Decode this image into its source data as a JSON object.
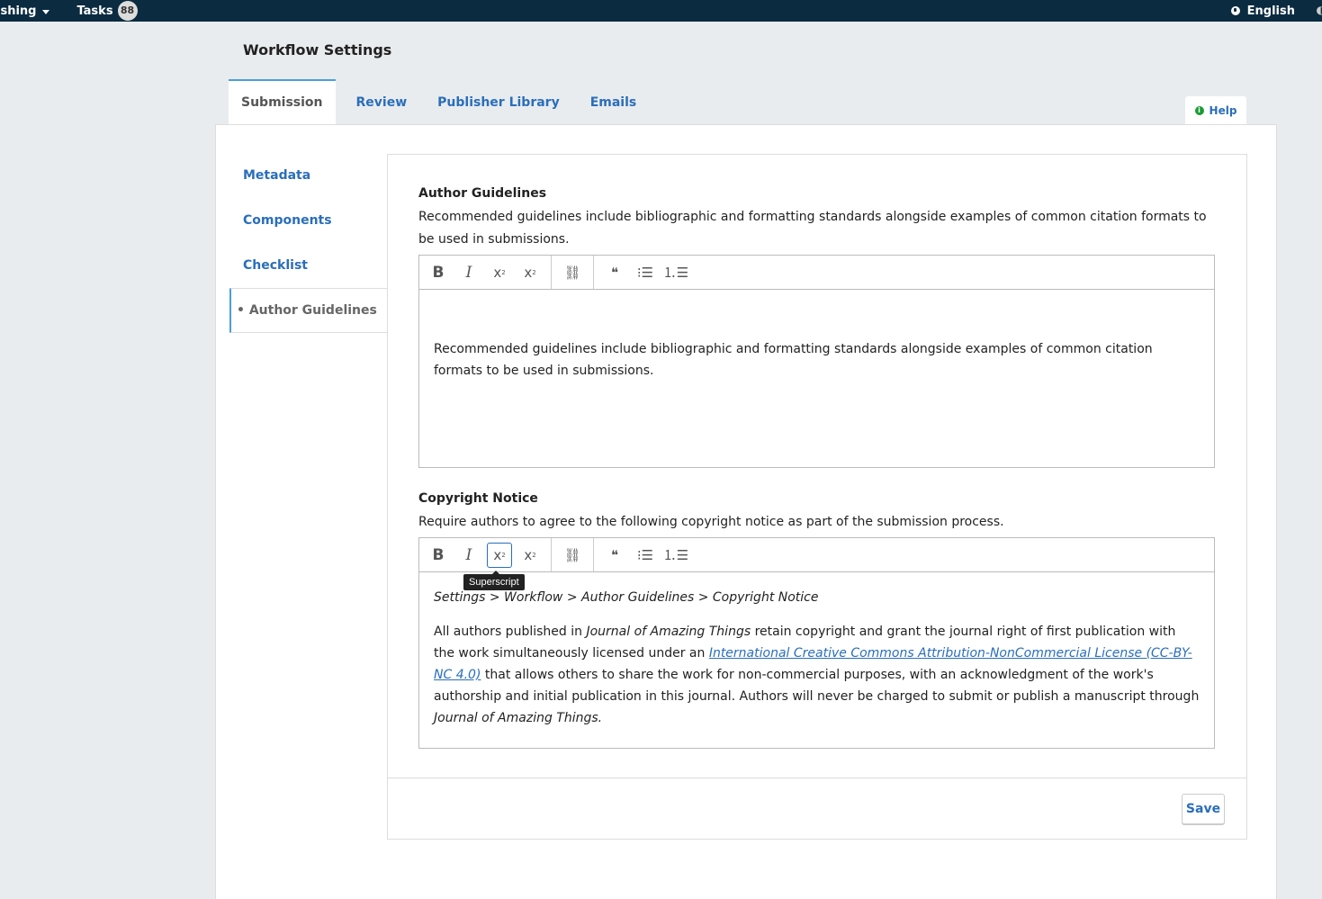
{
  "topbar": {
    "context_menu_label": "ishing",
    "tasks_label": "Tasks",
    "tasks_count": "88",
    "language_label": "English"
  },
  "page": {
    "title": "Workflow Settings"
  },
  "tabs": [
    {
      "label": "Submission",
      "active": true
    },
    {
      "label": "Review"
    },
    {
      "label": "Publisher Library"
    },
    {
      "label": "Emails"
    }
  ],
  "help": {
    "label": "Help"
  },
  "sidenav": [
    {
      "label": "Metadata"
    },
    {
      "label": "Components"
    },
    {
      "label": "Checklist"
    },
    {
      "label": "• Author Guidelines",
      "active": true
    }
  ],
  "author_guidelines": {
    "label": "Author Guidelines",
    "description": "Recommended guidelines include bibliographic and formatting standards alongside examples of common citation formats to be used in submissions.",
    "value": "Recommended guidelines include bibliographic and formatting standards alongside examples of common citation formats to be used in submissions."
  },
  "copyright_notice": {
    "label": "Copyright Notice",
    "description": "Require authors to agree to the following copyright notice as part of the submission process.",
    "breadcrumb": "Settings > Workflow > Author Guidelines > Copyright Notice",
    "p1": "All authors published in ",
    "journal": "Journal of Amazing Things",
    "p2": " retain copyright and grant the journal right of first publication with the work simultaneously licensed under an ",
    "license_link": "International Creative Commons Attribution-NonCommercial License (CC-BY-NC 4.0)",
    "p3": " that allows others to share the work for non-commercial purposes, with an acknowledgment of the work's authorship and initial publication in this journal. Authors will never be charged to submit or publish a manuscript through ",
    "journal2": "Journal of Amazing Things.",
    "tooltip": "Superscript"
  },
  "toolbar": {
    "bold": "B",
    "italic": "I",
    "superscript": "x",
    "subscript": "x",
    "link": "🔗",
    "quote": "❝",
    "bullet": "☰",
    "numbered": "☷"
  },
  "save_label": "Save"
}
